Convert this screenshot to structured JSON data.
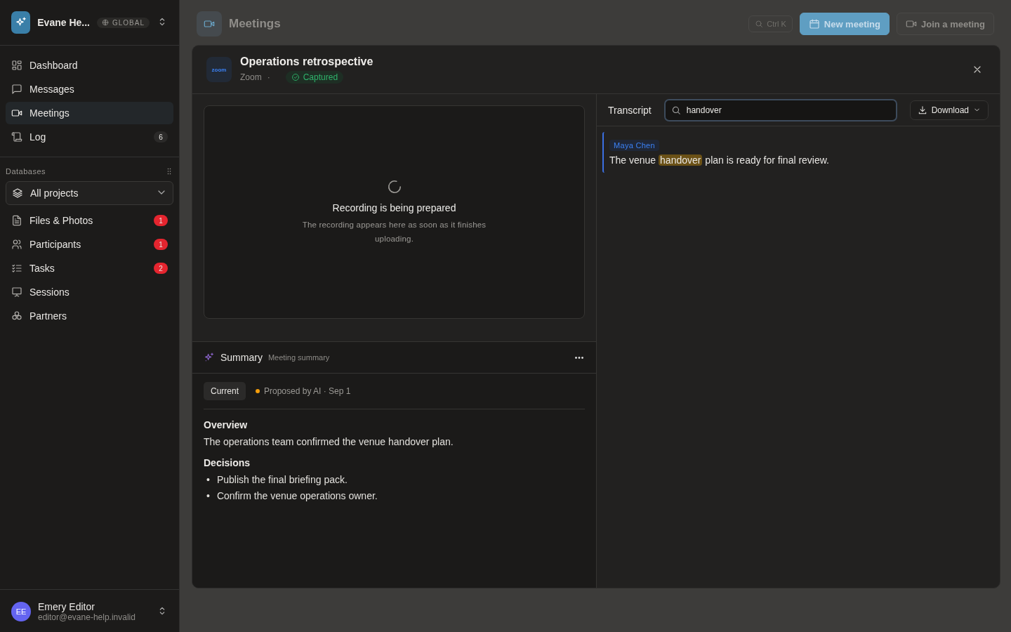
{
  "workspace": {
    "name": "Evane He...",
    "scope": "GLOBAL"
  },
  "nav": [
    {
      "label": "Dashboard",
      "selected": false
    },
    {
      "label": "Messages",
      "selected": false
    },
    {
      "label": "Meetings",
      "selected": true
    },
    {
      "label": "Log",
      "selected": false,
      "badge": "6",
      "color": "#2b2a29"
    }
  ],
  "databases": {
    "title": "Databases",
    "project_select": "All projects",
    "items": [
      {
        "label": "Files & Photos",
        "badge": "1",
        "color": "#e5252f"
      },
      {
        "label": "Participants",
        "badge": "1",
        "color": "#e5252f"
      },
      {
        "label": "Tasks",
        "badge": "2",
        "color": "#e5252f"
      },
      {
        "label": "Sessions"
      },
      {
        "label": "Partners"
      }
    ]
  },
  "user": {
    "initials": "EE",
    "name": "Emery Editor",
    "email": "editor@evane-help.invalid"
  },
  "header": {
    "title": "Meetings",
    "search_shortcut": "Ctrl K",
    "new_button": "New meeting",
    "join_button": "Join a meeting"
  },
  "dialog": {
    "title": "Operations retrospective",
    "logo": "zoom",
    "platform": "Zoom",
    "separator": "·",
    "status": "Captured",
    "recording": {
      "title": "Recording is being prepared",
      "text": "The recording appears here as soon as it finishes uploading."
    },
    "summary": {
      "title": "Summary",
      "subtitle": "Meeting summary",
      "version": "Current",
      "proposal": "Proposed by AI · Sep 1",
      "sections": [
        {
          "heading": "Overview",
          "kind": "paragraph",
          "text": "The operations team confirmed the venue handover plan."
        },
        {
          "heading": "Decisions",
          "kind": "bullets",
          "marker": "•",
          "items": [
            "Publish the final briefing pack.",
            "Confirm the venue operations owner."
          ]
        }
      ]
    },
    "transcript": {
      "title": "Transcript",
      "search_value": "handover",
      "download": "Download",
      "entries": [
        {
          "speaker": "Maya Chen",
          "segments": [
            {
              "text": "The venue ",
              "highlighted": false
            },
            {
              "text": "handover",
              "highlighted": true
            },
            {
              "text": " plan is ready for final review.",
              "highlighted": false
            }
          ]
        }
      ]
    }
  }
}
